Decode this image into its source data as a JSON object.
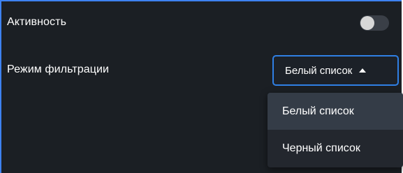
{
  "settings": {
    "activity_label": "Активность",
    "activity_enabled": false,
    "filter_mode_label": "Режим фильтрации",
    "filter_mode_value": "Белый список",
    "options": [
      {
        "label": "Белый список",
        "selected": true
      },
      {
        "label": "Черный список",
        "selected": false
      }
    ]
  },
  "colors": {
    "accent": "#3d82f0",
    "panel_background": "#1b1f24",
    "dropdown_background": "#23272e",
    "selected_option_background": "#343c47"
  },
  "icons": {
    "toggle": "toggle-switch",
    "caret": "caret-up-icon"
  }
}
